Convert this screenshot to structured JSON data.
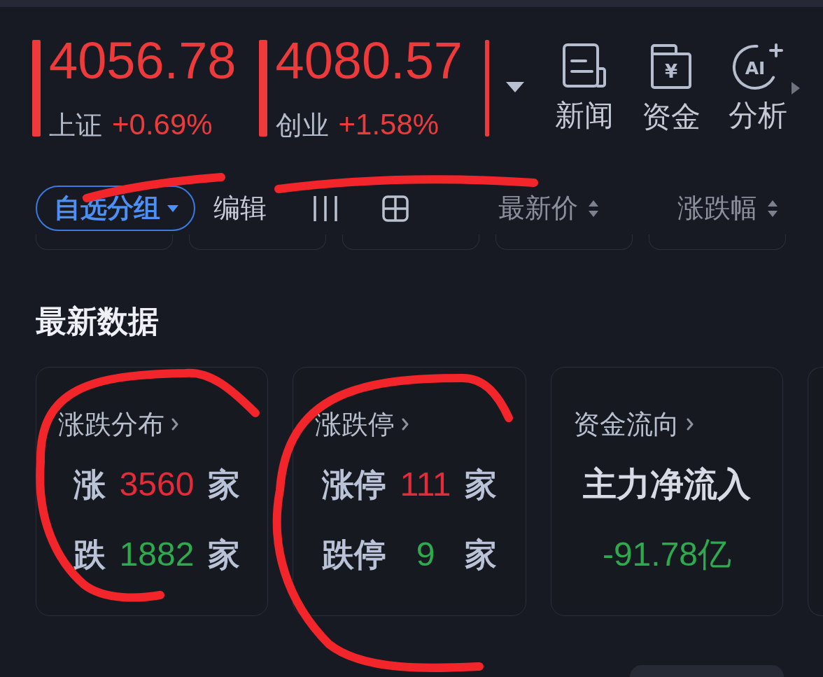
{
  "indices": [
    {
      "value": "4056.78",
      "name": "上证",
      "change": "+0.69%",
      "color": "#ee3a3a"
    },
    {
      "value": "4080.57",
      "name": "创业",
      "change": "+1.58%",
      "color": "#ee3a3a"
    },
    {
      "color": "#ee3a3a"
    }
  ],
  "quick_links": [
    {
      "label": "新闻"
    },
    {
      "label": "资金",
      "icon_text": "¥"
    },
    {
      "label": "分析",
      "icon_text": "AI"
    }
  ],
  "toolbar": {
    "group_button": "自选分组",
    "edit": "编辑",
    "sort_columns": [
      {
        "label": "最新价"
      },
      {
        "label": "涨跌幅"
      }
    ]
  },
  "latest_data": {
    "title": "最新数据",
    "cards": [
      {
        "kind": "counts",
        "title": "涨跌分布",
        "rows": [
          {
            "label": "涨",
            "count": "3560",
            "unit": "家",
            "color": "#e62a3a"
          },
          {
            "label": "跌",
            "count": "1882",
            "unit": "家",
            "color": "#2eaa4e"
          }
        ]
      },
      {
        "kind": "counts",
        "title": "涨跌停",
        "rows": [
          {
            "label": "涨停",
            "count": "111",
            "unit": "家",
            "color": "#e62a3a"
          },
          {
            "label": "跌停",
            "count": "9",
            "unit": "家",
            "color": "#2eaa4e"
          }
        ]
      },
      {
        "kind": "flow",
        "title": "资金流向",
        "label": "主力净流入",
        "value": "-91.78亿",
        "color": "#2eaa4e"
      }
    ]
  }
}
